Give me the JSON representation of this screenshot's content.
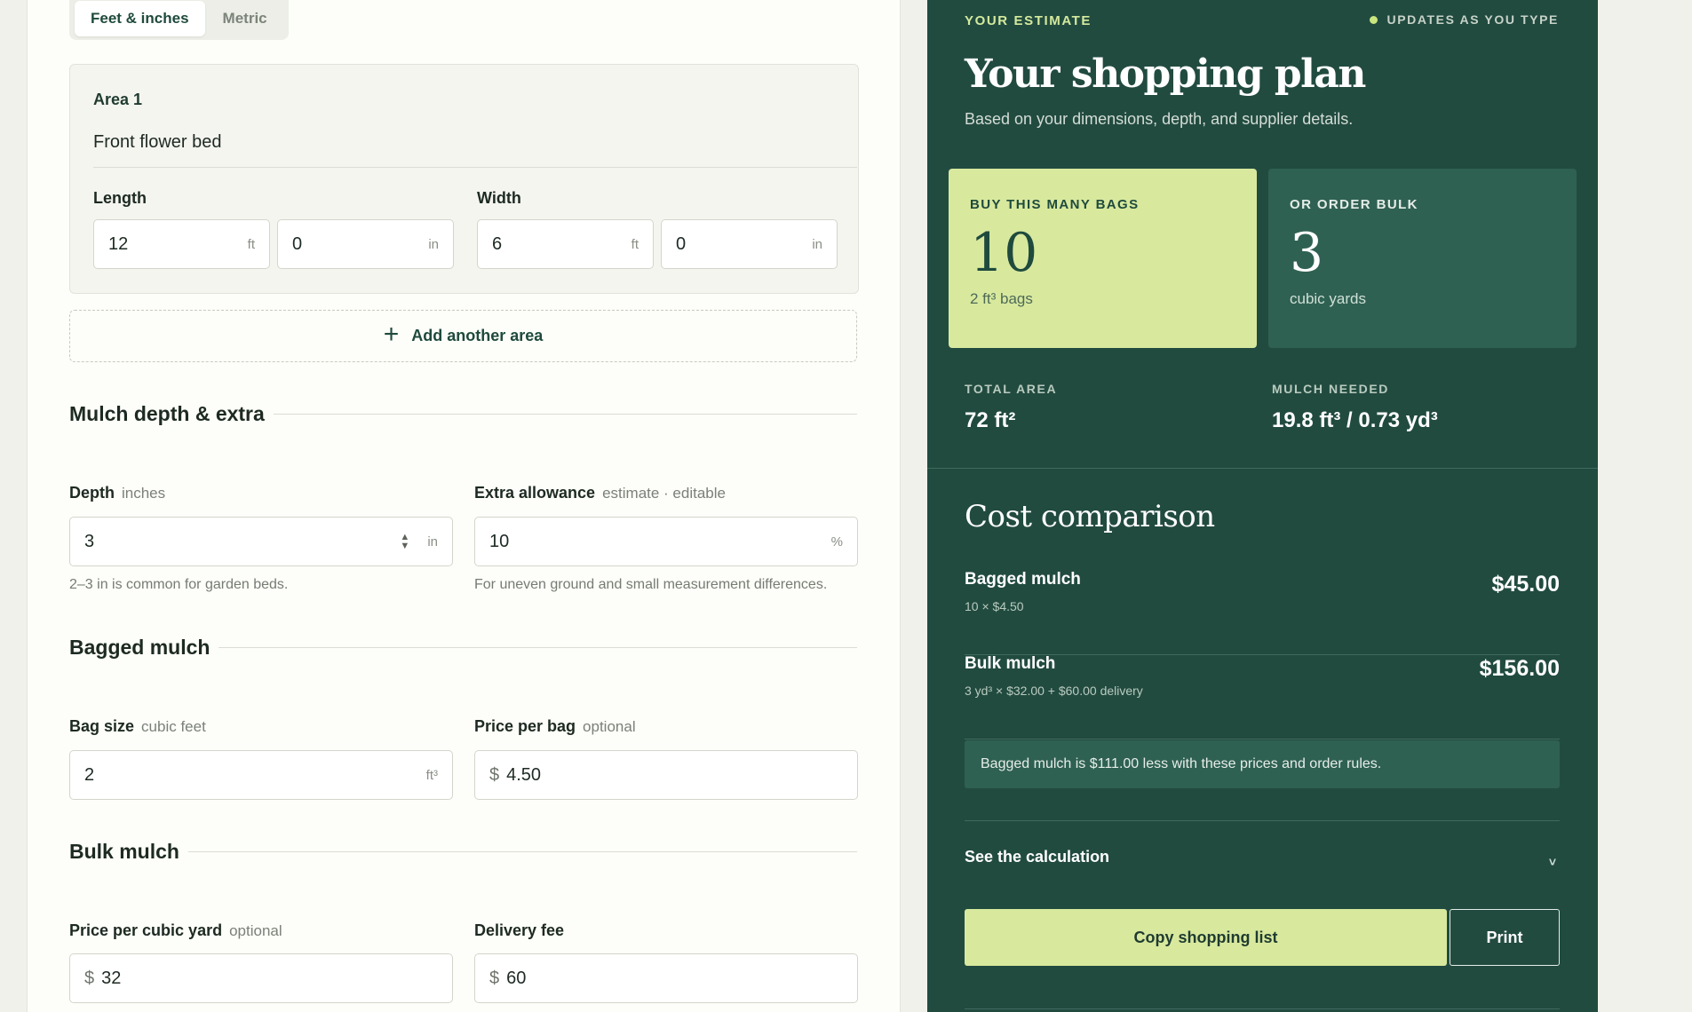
{
  "units": {
    "tabs": [
      "Feet & inches",
      "Metric"
    ],
    "active": "Feet & inches"
  },
  "area": {
    "title": "Area 1",
    "name": "Front flower bed",
    "length_label": "Length",
    "width_label": "Width",
    "length_ft": "12",
    "length_in": "0",
    "width_ft": "6",
    "width_in": "0",
    "ft_unit": "ft",
    "in_unit": "in"
  },
  "add_area_label": "Add another area",
  "depth_section": {
    "heading": "Mulch depth & extra",
    "depth_label": "Depth",
    "depth_hint": "inches",
    "depth_value": "3",
    "depth_unit": "in",
    "depth_help": "2–3 in is common for garden beds.",
    "extra_label": "Extra allowance",
    "extra_hint": "estimate · editable",
    "extra_value": "10",
    "extra_unit": "%",
    "extra_help": "For uneven ground and small measurement differences."
  },
  "bagged_section": {
    "heading": "Bagged mulch",
    "bag_size_label": "Bag size",
    "bag_size_hint": "cubic feet",
    "bag_size_value": "2",
    "bag_size_unit": "ft³",
    "price_label": "Price per bag",
    "price_hint": "optional",
    "price_prefix": "$",
    "price_value": "4.50"
  },
  "bulk_section": {
    "heading": "Bulk mulch",
    "price_label": "Price per cubic yard",
    "price_hint": "optional",
    "price_prefix": "$",
    "price_value": "32",
    "delivery_label": "Delivery fee",
    "delivery_prefix": "$",
    "delivery_value": "60"
  },
  "estimate": {
    "eyebrow": "YOUR ESTIMATE",
    "updates": "UPDATES AS YOU TYPE",
    "title": "Your shopping plan",
    "subtitle": "Based on your dimensions, depth, and supplier details.",
    "bags_label": "BUY THIS MANY BAGS",
    "bags_count": "10",
    "bags_unit": "2 ft³ bags",
    "bulk_label": "OR ORDER BULK",
    "bulk_count": "3",
    "bulk_unit": "cubic yards",
    "total_area_label": "TOTAL AREA",
    "total_area_value": "72 ft²",
    "mulch_needed_label": "MULCH NEEDED",
    "mulch_needed_value": "19.8 ft³ / 0.73 yd³"
  },
  "cost": {
    "title": "Cost comparison",
    "rows": [
      {
        "name": "Bagged mulch",
        "detail": "10 × $4.50",
        "price": "$45.00"
      },
      {
        "name": "Bulk mulch",
        "detail": "3 yd³ × $32.00 + $60.00 delivery",
        "price": "$156.00"
      }
    ],
    "savings": "Bagged mulch is $111.00 less with these prices and order rules.",
    "calc_toggle": "See the calculation",
    "copy_button": "Copy shopping list",
    "print_button": "Print"
  },
  "colors": {
    "panel": "#224b40",
    "accent": "#d8e99e",
    "card_dark": "#2f6153"
  },
  "icons": {
    "add": "plus-icon",
    "status": "dot-icon",
    "expand": "chevron-down-icon",
    "stepper": "stepper-arrows-icon"
  }
}
